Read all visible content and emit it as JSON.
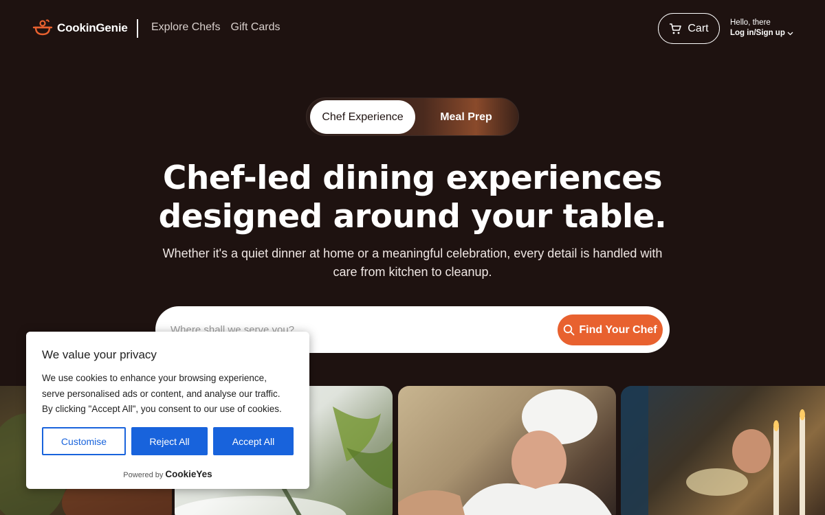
{
  "header": {
    "brand": "CookinGenie",
    "nav": [
      "Explore Chefs",
      "Gift Cards"
    ],
    "cart_label": "Cart",
    "greeting": "Hello, there",
    "login_label": "Log in/Sign up"
  },
  "toggle": {
    "active": "Chef Experience",
    "other": "Meal Prep"
  },
  "hero": {
    "title_line1": "Chef-led dining experiences",
    "title_line2": "designed around your table.",
    "subtitle_line1": "Whether it's a quiet dinner at home or a meaningful celebration, every detail is handled with",
    "subtitle_line2": "care from kitchen to cleanup."
  },
  "search": {
    "placeholder": "Where shall we serve you?",
    "button_label": "Find Your Chef"
  },
  "cookie": {
    "title": "We value your privacy",
    "body_line1": "We use cookies to enhance your browsing experience,",
    "body_line2": "serve personalised ads or content, and analyse our traffic.",
    "body_line3": "By clicking \"Accept All\", you consent to our use of cookies.",
    "customise": "Customise",
    "reject": "Reject All",
    "accept": "Accept All",
    "powered_by": "Powered by",
    "powered_brand": "CookieYes"
  },
  "colors": {
    "background": "#1e1210",
    "accent": "#e8612f",
    "cookie_blue": "#1863dc"
  },
  "icons": [
    "chef-pot-logo-icon",
    "cart-icon",
    "chevron-down-icon",
    "search-icon"
  ]
}
